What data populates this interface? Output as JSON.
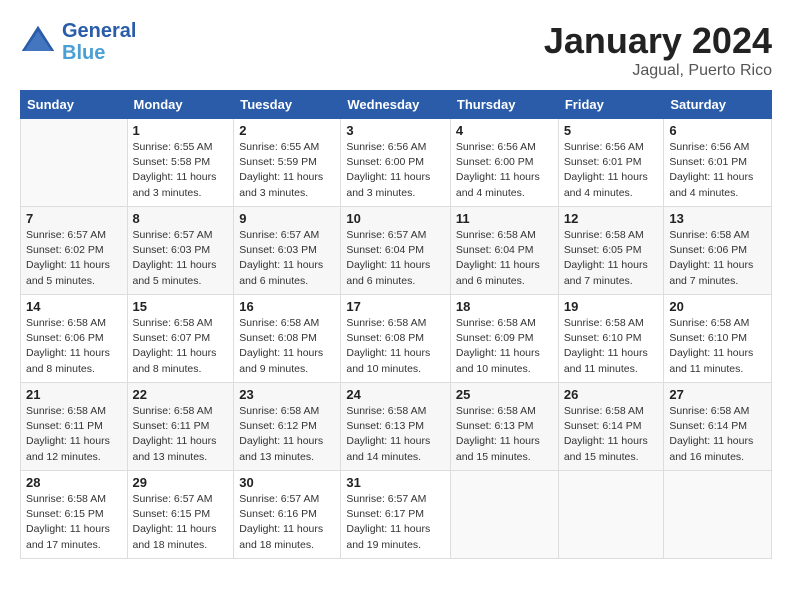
{
  "logo": {
    "text_general": "General",
    "text_blue": "Blue"
  },
  "header": {
    "month": "January 2024",
    "location": "Jagual, Puerto Rico"
  },
  "weekdays": [
    "Sunday",
    "Monday",
    "Tuesday",
    "Wednesday",
    "Thursday",
    "Friday",
    "Saturday"
  ],
  "weeks": [
    [
      {
        "day": "",
        "info": ""
      },
      {
        "day": "1",
        "info": "Sunrise: 6:55 AM\nSunset: 5:58 PM\nDaylight: 11 hours\nand 3 minutes."
      },
      {
        "day": "2",
        "info": "Sunrise: 6:55 AM\nSunset: 5:59 PM\nDaylight: 11 hours\nand 3 minutes."
      },
      {
        "day": "3",
        "info": "Sunrise: 6:56 AM\nSunset: 6:00 PM\nDaylight: 11 hours\nand 3 minutes."
      },
      {
        "day": "4",
        "info": "Sunrise: 6:56 AM\nSunset: 6:00 PM\nDaylight: 11 hours\nand 4 minutes."
      },
      {
        "day": "5",
        "info": "Sunrise: 6:56 AM\nSunset: 6:01 PM\nDaylight: 11 hours\nand 4 minutes."
      },
      {
        "day": "6",
        "info": "Sunrise: 6:56 AM\nSunset: 6:01 PM\nDaylight: 11 hours\nand 4 minutes."
      }
    ],
    [
      {
        "day": "7",
        "info": "Sunrise: 6:57 AM\nSunset: 6:02 PM\nDaylight: 11 hours\nand 5 minutes."
      },
      {
        "day": "8",
        "info": "Sunrise: 6:57 AM\nSunset: 6:03 PM\nDaylight: 11 hours\nand 5 minutes."
      },
      {
        "day": "9",
        "info": "Sunrise: 6:57 AM\nSunset: 6:03 PM\nDaylight: 11 hours\nand 6 minutes."
      },
      {
        "day": "10",
        "info": "Sunrise: 6:57 AM\nSunset: 6:04 PM\nDaylight: 11 hours\nand 6 minutes."
      },
      {
        "day": "11",
        "info": "Sunrise: 6:58 AM\nSunset: 6:04 PM\nDaylight: 11 hours\nand 6 minutes."
      },
      {
        "day": "12",
        "info": "Sunrise: 6:58 AM\nSunset: 6:05 PM\nDaylight: 11 hours\nand 7 minutes."
      },
      {
        "day": "13",
        "info": "Sunrise: 6:58 AM\nSunset: 6:06 PM\nDaylight: 11 hours\nand 7 minutes."
      }
    ],
    [
      {
        "day": "14",
        "info": "Sunrise: 6:58 AM\nSunset: 6:06 PM\nDaylight: 11 hours\nand 8 minutes."
      },
      {
        "day": "15",
        "info": "Sunrise: 6:58 AM\nSunset: 6:07 PM\nDaylight: 11 hours\nand 8 minutes."
      },
      {
        "day": "16",
        "info": "Sunrise: 6:58 AM\nSunset: 6:08 PM\nDaylight: 11 hours\nand 9 minutes."
      },
      {
        "day": "17",
        "info": "Sunrise: 6:58 AM\nSunset: 6:08 PM\nDaylight: 11 hours\nand 10 minutes."
      },
      {
        "day": "18",
        "info": "Sunrise: 6:58 AM\nSunset: 6:09 PM\nDaylight: 11 hours\nand 10 minutes."
      },
      {
        "day": "19",
        "info": "Sunrise: 6:58 AM\nSunset: 6:10 PM\nDaylight: 11 hours\nand 11 minutes."
      },
      {
        "day": "20",
        "info": "Sunrise: 6:58 AM\nSunset: 6:10 PM\nDaylight: 11 hours\nand 11 minutes."
      }
    ],
    [
      {
        "day": "21",
        "info": "Sunrise: 6:58 AM\nSunset: 6:11 PM\nDaylight: 11 hours\nand 12 minutes."
      },
      {
        "day": "22",
        "info": "Sunrise: 6:58 AM\nSunset: 6:11 PM\nDaylight: 11 hours\nand 13 minutes."
      },
      {
        "day": "23",
        "info": "Sunrise: 6:58 AM\nSunset: 6:12 PM\nDaylight: 11 hours\nand 13 minutes."
      },
      {
        "day": "24",
        "info": "Sunrise: 6:58 AM\nSunset: 6:13 PM\nDaylight: 11 hours\nand 14 minutes."
      },
      {
        "day": "25",
        "info": "Sunrise: 6:58 AM\nSunset: 6:13 PM\nDaylight: 11 hours\nand 15 minutes."
      },
      {
        "day": "26",
        "info": "Sunrise: 6:58 AM\nSunset: 6:14 PM\nDaylight: 11 hours\nand 15 minutes."
      },
      {
        "day": "27",
        "info": "Sunrise: 6:58 AM\nSunset: 6:14 PM\nDaylight: 11 hours\nand 16 minutes."
      }
    ],
    [
      {
        "day": "28",
        "info": "Sunrise: 6:58 AM\nSunset: 6:15 PM\nDaylight: 11 hours\nand 17 minutes."
      },
      {
        "day": "29",
        "info": "Sunrise: 6:57 AM\nSunset: 6:15 PM\nDaylight: 11 hours\nand 18 minutes."
      },
      {
        "day": "30",
        "info": "Sunrise: 6:57 AM\nSunset: 6:16 PM\nDaylight: 11 hours\nand 18 minutes."
      },
      {
        "day": "31",
        "info": "Sunrise: 6:57 AM\nSunset: 6:17 PM\nDaylight: 11 hours\nand 19 minutes."
      },
      {
        "day": "",
        "info": ""
      },
      {
        "day": "",
        "info": ""
      },
      {
        "day": "",
        "info": ""
      }
    ]
  ]
}
